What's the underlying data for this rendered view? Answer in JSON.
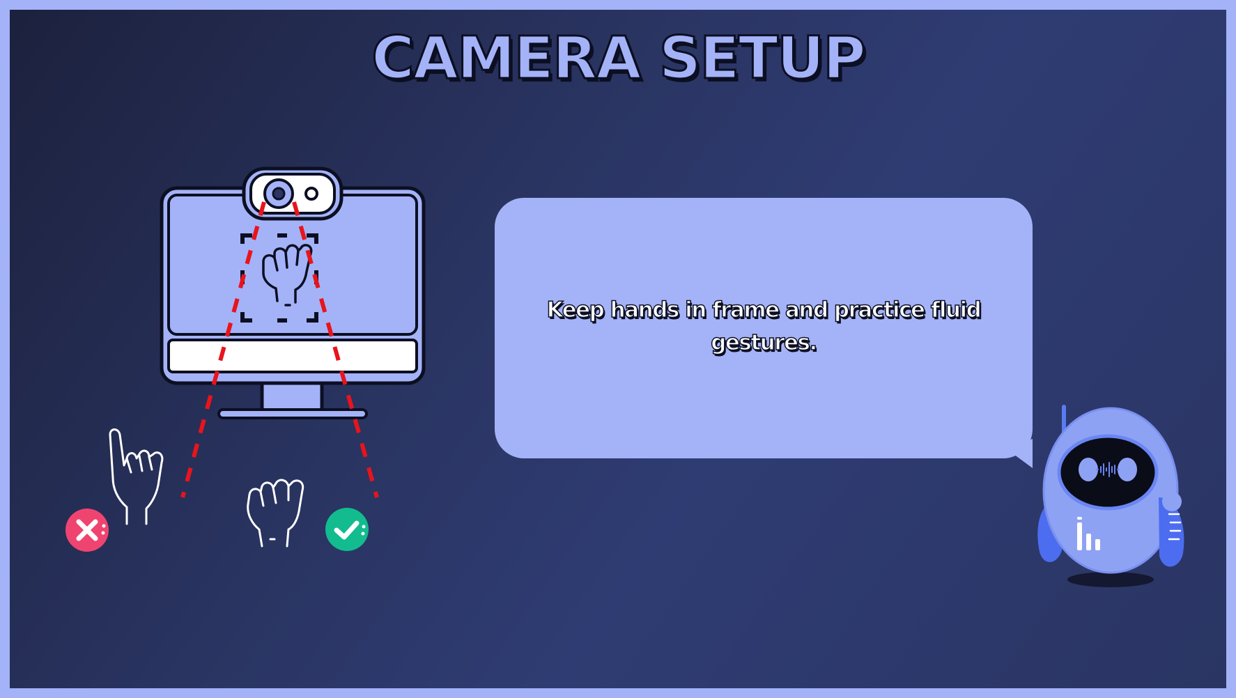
{
  "title": "CAMERA SETUP",
  "instruction": "Keep hands in frame and practice fluid gestures.",
  "icons": {
    "monitor": "monitor-icon",
    "webcam": "webcam-icon",
    "incorrect_hand": "pointing-hand-icon",
    "correct_hand": "fist-hand-icon",
    "incorrect_mark": "cross-circle-icon",
    "correct_mark": "check-circle-icon",
    "mascot": "robot-mascot-icon"
  },
  "colors": {
    "background_dark": "#1c213d",
    "background_mid": "#2f3c73",
    "accent": "#a4b3f8",
    "outline": "#0c0f22",
    "camera_range": "#e8141c",
    "incorrect": "#ef4470",
    "correct": "#12bc8e",
    "robot_blue": "#5a7cf0"
  }
}
